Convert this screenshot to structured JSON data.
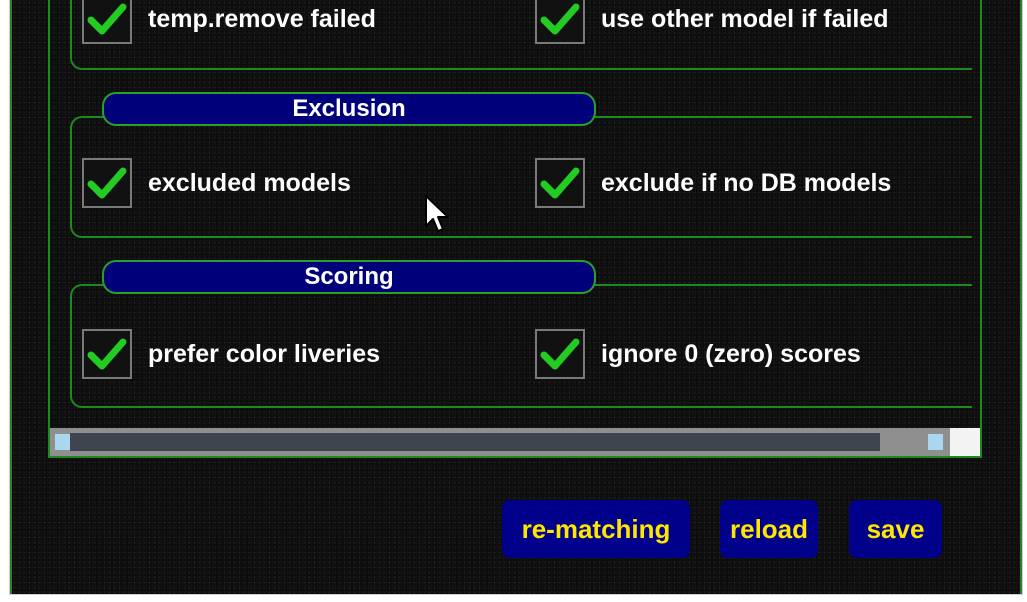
{
  "groups": [
    {
      "legend": "",
      "options": [
        {
          "label": "temp.remove failed",
          "checked": true
        },
        {
          "label": "use other model if failed",
          "checked": true
        }
      ]
    },
    {
      "legend": "Exclusion",
      "options": [
        {
          "label": "excluded models",
          "checked": true
        },
        {
          "label": "exclude if no DB models",
          "checked": true
        }
      ]
    },
    {
      "legend": "Scoring",
      "options": [
        {
          "label": "prefer color liveries",
          "checked": true
        },
        {
          "label": "ignore 0 (zero) scores",
          "checked": true
        }
      ]
    }
  ],
  "buttons": {
    "rematching": "re-matching",
    "reload": "reload",
    "save": "save"
  },
  "colors": {
    "background": "#0c0c0c",
    "border_green": "#1d8a1d",
    "legend_bg": "#00007a",
    "button_bg": "#00008a",
    "button_text": "#ffe600",
    "check_green": "#22cc22"
  }
}
